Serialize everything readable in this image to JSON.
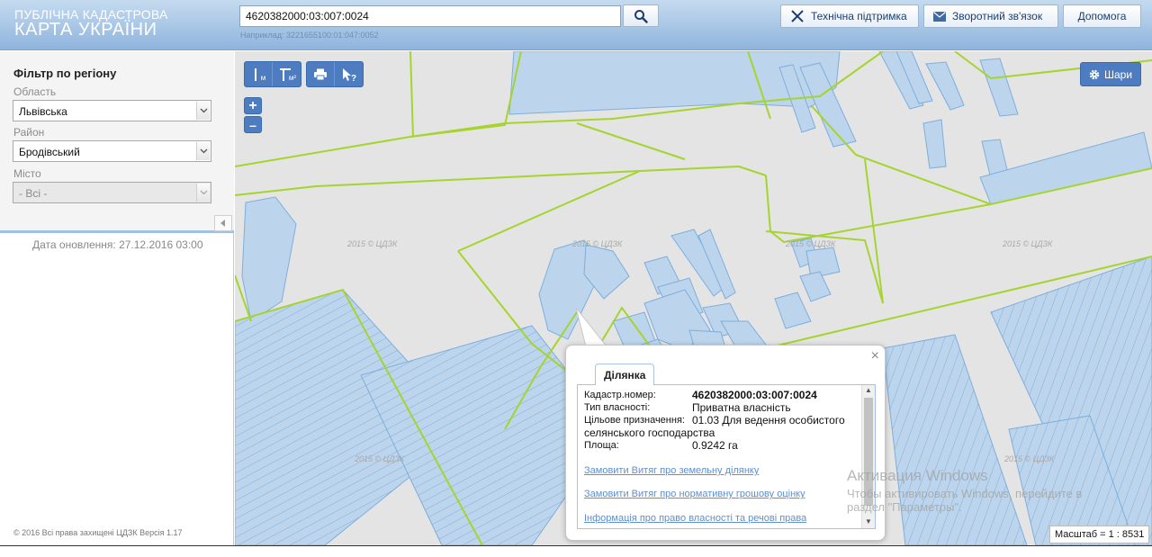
{
  "header": {
    "logo_line1": "ПУБЛІЧНА КАДАСТРОВА",
    "logo_line2": "КАРТА УКРАЇНИ",
    "search_value": "4620382000:03:007:0024",
    "search_hint": "Наприклад: 3221655100:01:047:0052",
    "buttons": {
      "support": "Технічна підтримка",
      "feedback": "Зворотний зв'язок",
      "help": "Допомога"
    }
  },
  "sidebar": {
    "filter_title": "Фільтр по регіону",
    "region_label": "Область",
    "region_value": "Львівська",
    "district_label": "Район",
    "district_value": "Бродівський",
    "city_label": "Місто",
    "city_value": "- Всі -",
    "update_date": "Дата оновлення: 27.12.2016 03:00",
    "copyright": "© 2016 Всі права захищені  ЦДЗК  Версія 1.17"
  },
  "map": {
    "tools": {
      "measure_length": "м",
      "measure_area": "м²"
    },
    "zoom_in": "+",
    "zoom_out": "–",
    "layers_label": "Шари",
    "watermark": "2015 © ЦДЗК",
    "scale": "Масштаб = 1 : 8531"
  },
  "popup": {
    "tab": "Ділянка",
    "close": "×",
    "cadastral_label": "Кадастр.номер:",
    "cadastral_value": "4620382000:03:007:0024",
    "ownership_label": "Тип власності:",
    "ownership_value": "Приватна власність",
    "purpose_label": "Цільове призначення:",
    "purpose_value": "01.03 Для ведення особистого",
    "purpose_value_cont": "селянського господарства",
    "area_label": "Площа:",
    "area_value": "0.9242 га",
    "links": [
      "Замовити Витяг про земельну ділянку",
      "Замовити Витяг про нормативну грошову оцінку",
      "Інформація про право власності та речові права"
    ]
  },
  "windows_activation": {
    "title": "Активация Windows",
    "line2": "Чтобы активировать Windows, перейдите в",
    "line3": "раздел \"Параметры\"."
  },
  "colors": {
    "parcel_fill": "#bcd5ec",
    "parcel_stroke": "#7eaedb",
    "boundary": "#a6d42e",
    "tool_blue": "#4d7cc0"
  }
}
